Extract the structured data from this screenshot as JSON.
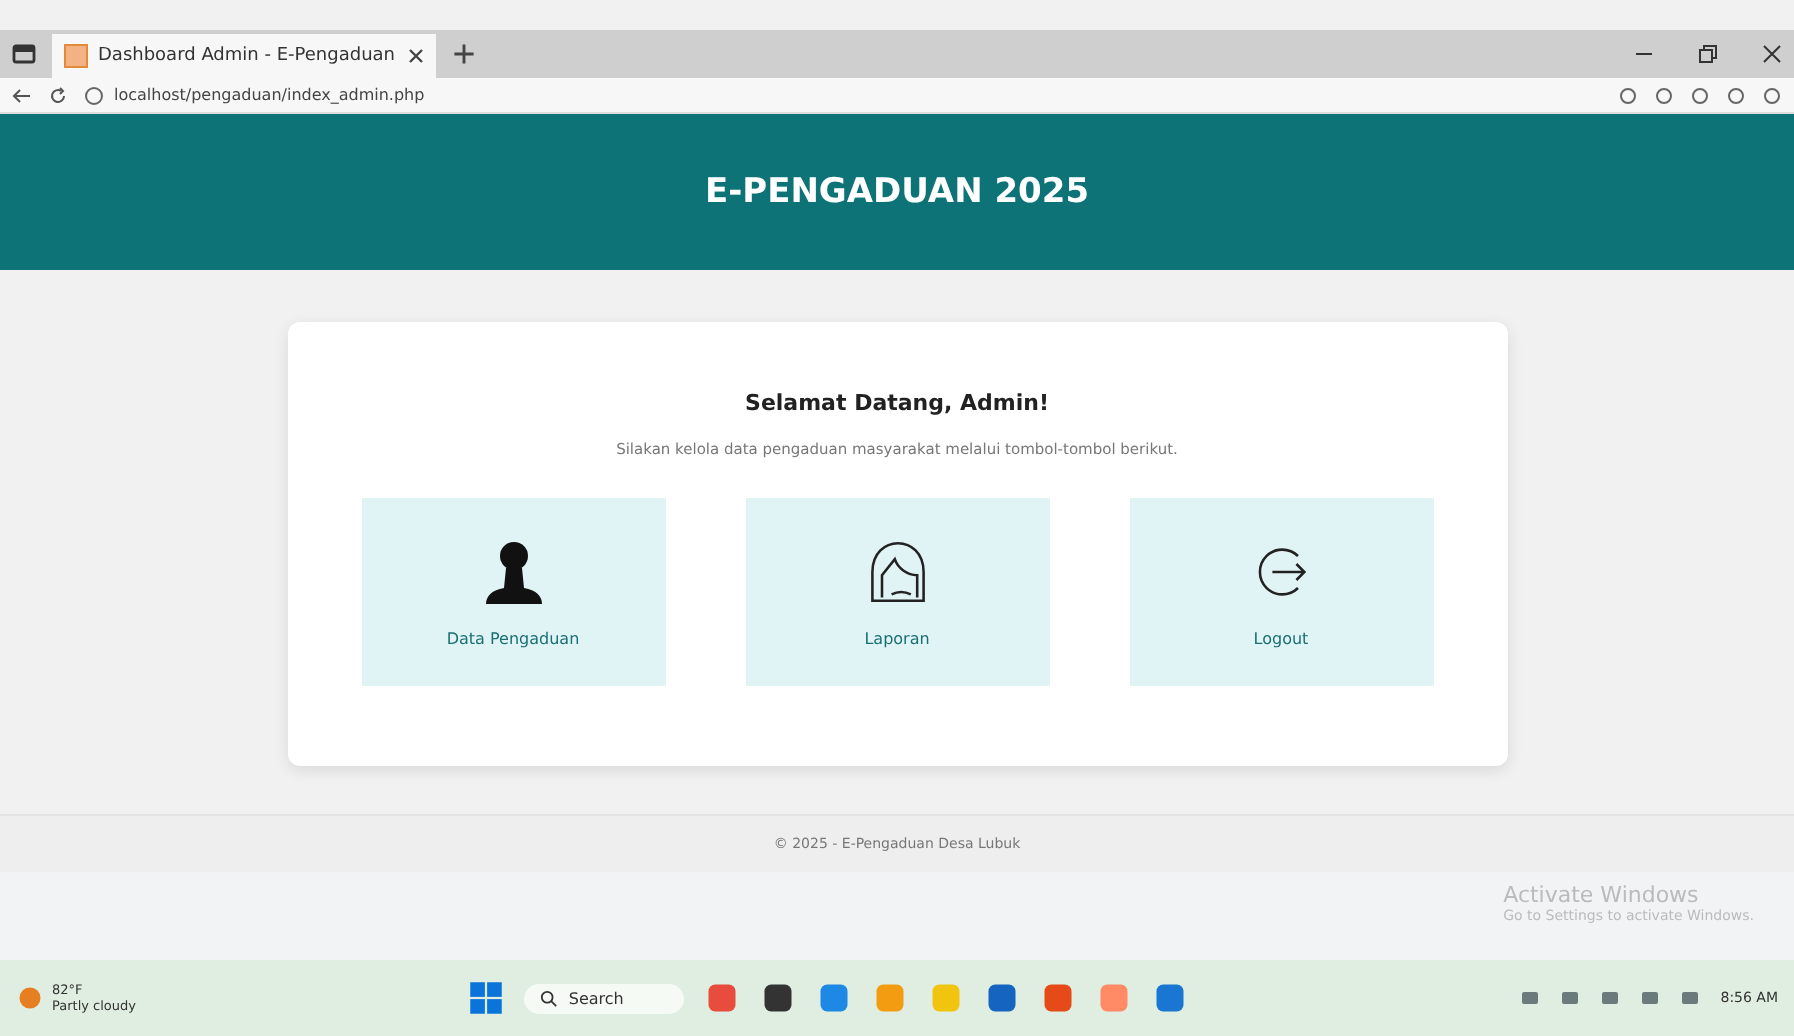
{
  "browser": {
    "tab_title": "Dashboard Admin - E-Pengaduan",
    "url": "localhost/pengaduan/index_admin.php"
  },
  "header": {
    "title": "E-PENGADUAN 2025"
  },
  "card": {
    "heading": "Selamat Datang, Admin!",
    "subtitle": "Silakan kelola data pengaduan masyarakat melalui tombol-tombol berikut.",
    "menu": [
      {
        "kind": "person",
        "label": "Data Pengaduan"
      },
      {
        "kind": "report",
        "label": "Laporan"
      },
      {
        "kind": "logout",
        "label": "Logout"
      }
    ]
  },
  "footer": {
    "text": "© 2025 - E-Pengaduan Desa Lubuk"
  },
  "activation": {
    "title": "Activate Windows",
    "hint": "Go to Settings to activate Windows."
  },
  "taskbar": {
    "temperature": "82°F",
    "weather": "Partly cloudy",
    "search": "Search",
    "time": "8:56 AM"
  }
}
